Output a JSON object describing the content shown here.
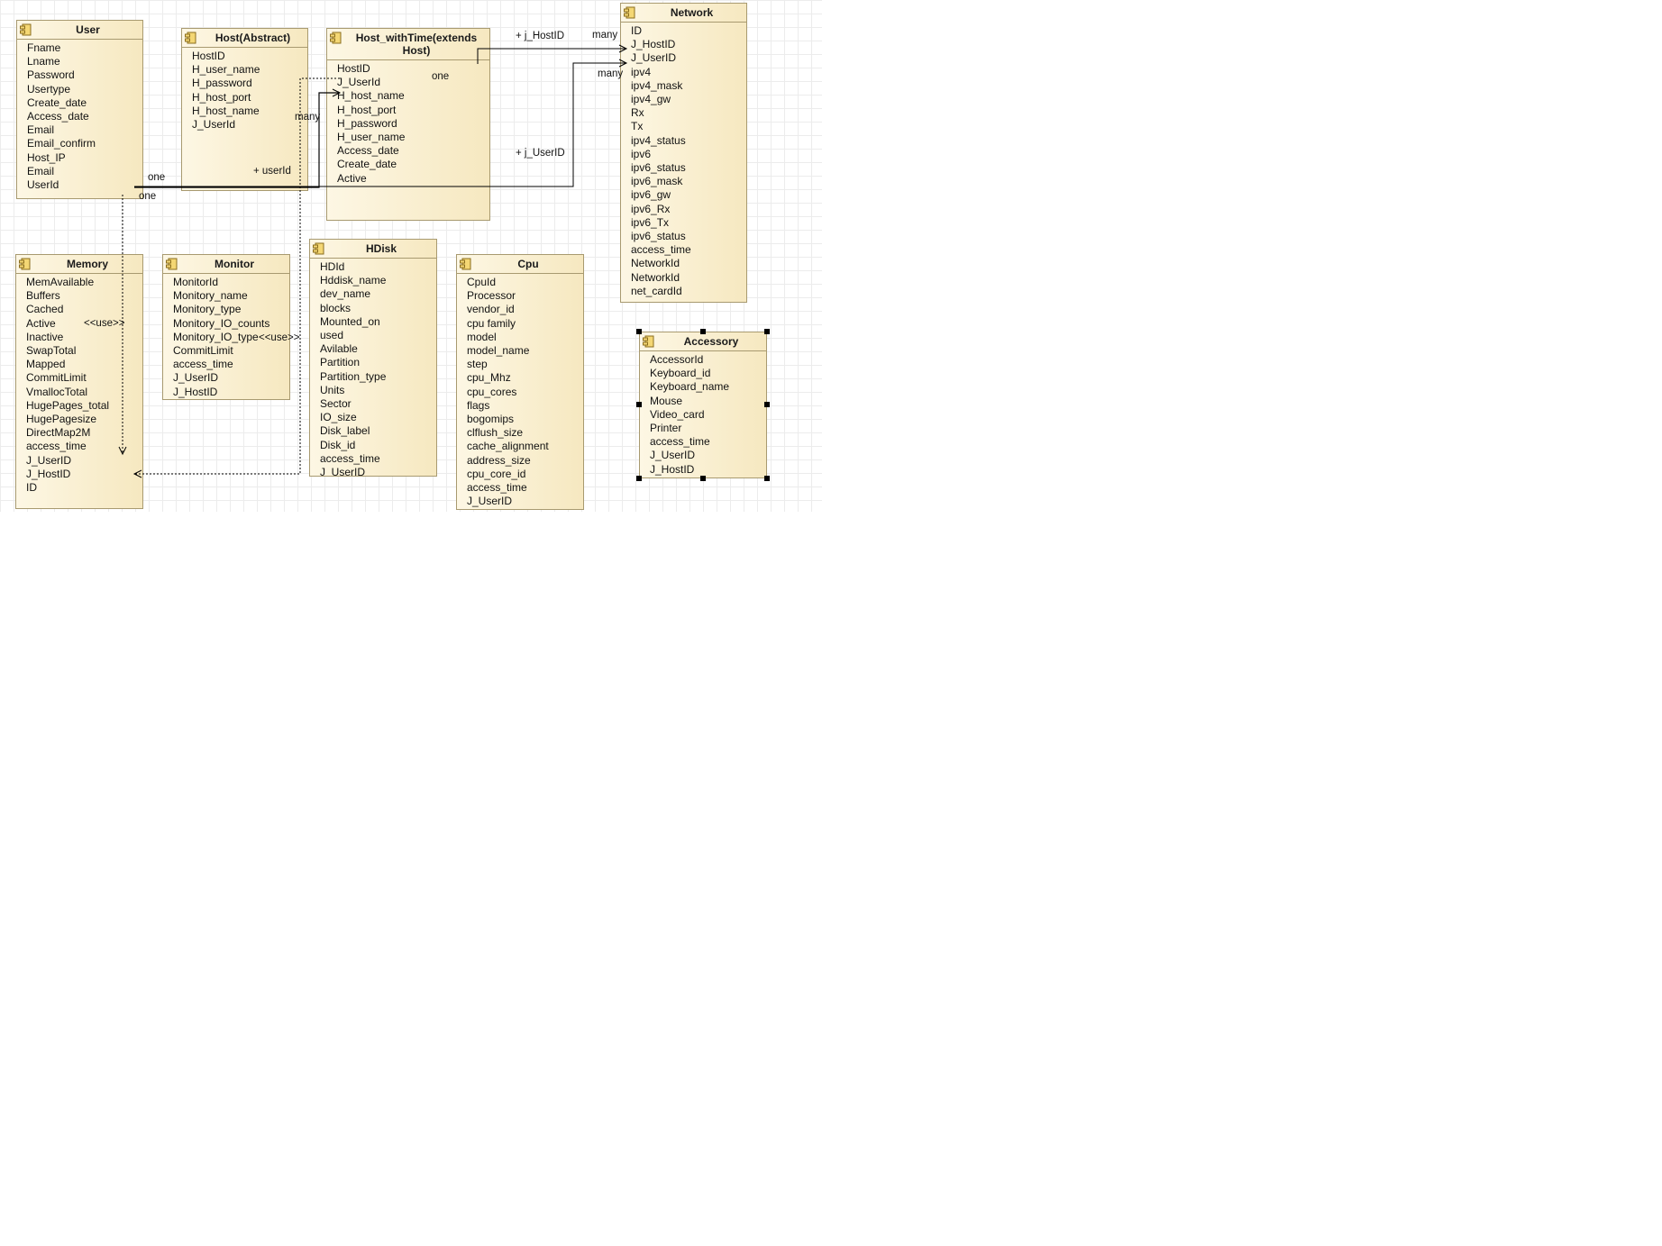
{
  "diagram": {
    "classes": {
      "user": {
        "name": "User",
        "attributes": [
          "Fname",
          "Lname",
          "Password",
          "Usertype",
          "Create_date",
          "Access_date",
          "Email",
          "Email_confirm",
          "Host_IP",
          "Email",
          "UserId"
        ]
      },
      "host_abstract": {
        "name": "Host(Abstract)",
        "attributes": [
          "HostID",
          "H_user_name",
          "H_password",
          "H_host_port",
          "H_host_name",
          "J_UserId"
        ]
      },
      "host_with_time": {
        "name": "Host_withTime(extends Host)",
        "attributes": [
          "HostID",
          "J_UserId",
          "H_host_name",
          "H_host_port",
          "H_password",
          "H_user_name",
          "Access_date",
          "Create_date",
          "Active"
        ]
      },
      "network": {
        "name": "Network",
        "attributes": [
          "ID",
          "J_HostID",
          "J_UserID",
          "ipv4",
          "ipv4_mask",
          "ipv4_gw",
          "Rx",
          "Tx",
          "ipv4_status",
          "ipv6",
          "ipv6_status",
          "ipv6_mask",
          "ipv6_gw",
          "ipv6_Rx",
          "ipv6_Tx",
          "ipv6_status",
          "access_time",
          "NetworkId",
          "NetworkId",
          "net_cardId"
        ]
      },
      "memory": {
        "name": "Memory",
        "attributes": [
          "MemAvailable",
          "Buffers",
          "Cached",
          "Active",
          "Inactive",
          "SwapTotal",
          "Mapped",
          "CommitLimit",
          "VmallocTotal",
          "HugePages_total",
          "HugePagesize",
          "DirectMap2M",
          "access_time",
          "J_UserID",
          "J_HostID",
          "ID"
        ]
      },
      "monitor": {
        "name": "Monitor",
        "attributes": [
          "MonitorId",
          "Monitory_name",
          "Monitory_type",
          "Monitory_IO_counts",
          "Monitory_IO_type",
          "CommitLimit",
          "access_time",
          "J_UserID",
          "J_HostID"
        ]
      },
      "hdisk": {
        "name": "HDisk",
        "attributes": [
          "HDId",
          "Hddisk_name",
          "dev_name",
          "blocks",
          "Mounted_on",
          "used",
          "Avilable",
          "Partition",
          "Partition_type",
          "Units",
          "Sector",
          "IO_size",
          "Disk_label",
          "Disk_id",
          "access_time",
          "J_UserID"
        ]
      },
      "cpu": {
        "name": "Cpu",
        "attributes": [
          "CpuId",
          "Processor",
          "vendor_id",
          "cpu family",
          "model",
          "model_name",
          "step",
          "cpu_Mhz",
          "cpu_cores",
          "flags",
          "bogomips",
          "clflush_size",
          "cache_alignment",
          "address_size",
          "cpu_core_id",
          "access_time",
          "J_UserID"
        ]
      },
      "accessory": {
        "name": "Accessory",
        "attributes": [
          "AccessorId",
          "Keyboard_id",
          "Keyboard_name",
          "Mouse",
          "Video_card",
          "Printer",
          "access_time",
          "J_UserID",
          "J_HostID"
        ]
      }
    },
    "edge_labels": {
      "user_one_a": "one",
      "user_one_b": "one",
      "host_userid": "+ userId",
      "host_many": "many",
      "hwt_one": "one",
      "net_jhostid": "+ j_HostID",
      "net_many_a": "many",
      "net_many_b": "many",
      "net_juserid": "+ j_UserID",
      "use_memory": "<<use>>",
      "use_monitor": "<<use>>"
    },
    "colors": {
      "class_fill_light": "#fdf7e4",
      "class_fill_dark": "#f6e8c0",
      "class_border": "#a89a70",
      "icon": "#e8c65a",
      "grid": "#ececec",
      "edge": "#000000"
    }
  }
}
